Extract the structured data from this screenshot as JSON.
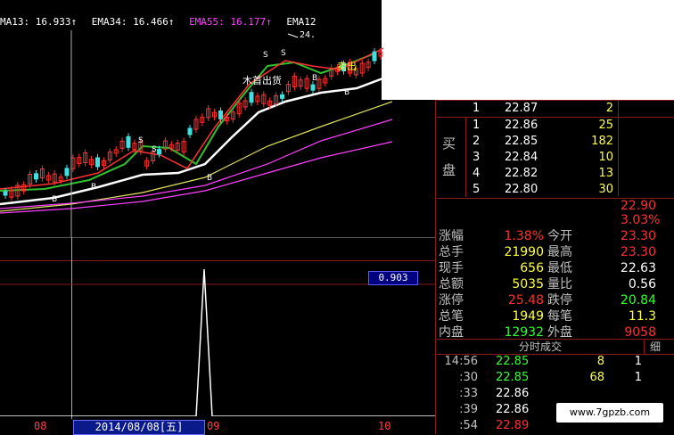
{
  "ema_bar": {
    "ema13": "MA13: 16.933↑",
    "ema34": "EMA34: 16.466↑",
    "ema55": "EMA55: 16.177↑",
    "ema120": "EMA12"
  },
  "chart": {
    "peak_label": "24.",
    "annotations": [
      "S",
      "S",
      "S",
      "S",
      "B",
      "B",
      "B",
      "B",
      "B"
    ],
    "text_overlay_1": "木首出货",
    "text_overlay_2": "卖出"
  },
  "indicator": {
    "value": "0.903"
  },
  "date_bar": {
    "left_label": "08",
    "date": "2014/08/08[五]",
    "mid_label": "09",
    "right_label": "10"
  },
  "order_book": {
    "top_row": {
      "idx": "1",
      "price": "22.87",
      "vol": "2"
    },
    "bid_label_1": "买",
    "bid_label_2": "盘",
    "bids": [
      {
        "idx": "1",
        "price": "22.86",
        "vol": "25"
      },
      {
        "idx": "2",
        "price": "22.85",
        "vol": "182"
      },
      {
        "idx": "3",
        "price": "22.84",
        "vol": "10"
      },
      {
        "idx": "4",
        "price": "22.82",
        "vol": "13"
      },
      {
        "idx": "5",
        "price": "22.80",
        "vol": "30"
      }
    ]
  },
  "quote": {
    "last": "22.90",
    "pct": "3.03%",
    "rows": [
      {
        "l1": "涨幅",
        "v1": "1.38%",
        "l2": "今开",
        "v2": "23.30"
      },
      {
        "l1": "总手",
        "v1": "21990",
        "l2": "最高",
        "v2": "23.30"
      },
      {
        "l1": "现手",
        "v1": "656",
        "l2": "最低",
        "v2": "22.63"
      },
      {
        "l1": "总额",
        "v1": "5035",
        "l2": "量比",
        "v2": "0.56"
      },
      {
        "l1": "涨停",
        "v1": "25.48",
        "l2": "跌停",
        "v2": "20.84"
      },
      {
        "l1": "总笔",
        "v1": "1949",
        "l2": "每笔",
        "v2": "11.3"
      },
      {
        "l1": "内盘",
        "v1": "12932",
        "l2": "外盘",
        "v2": "9058"
      }
    ]
  },
  "ticks": {
    "title": "分时成交",
    "detail_button": "细",
    "rows": [
      {
        "t": "14:56",
        "p": "22.85",
        "v": "8",
        "n": "1"
      },
      {
        "t": ":30",
        "p": "22.85",
        "v": "68",
        "n": "1"
      },
      {
        "t": ":33",
        "p": "22.86",
        "v": "",
        "n": ""
      },
      {
        "t": ":39",
        "p": "22.86",
        "v": "",
        "n": ""
      },
      {
        "t": ":54",
        "p": "22.89",
        "v": "",
        "n": ""
      }
    ]
  },
  "watermark": "www.7gpzb.com"
}
